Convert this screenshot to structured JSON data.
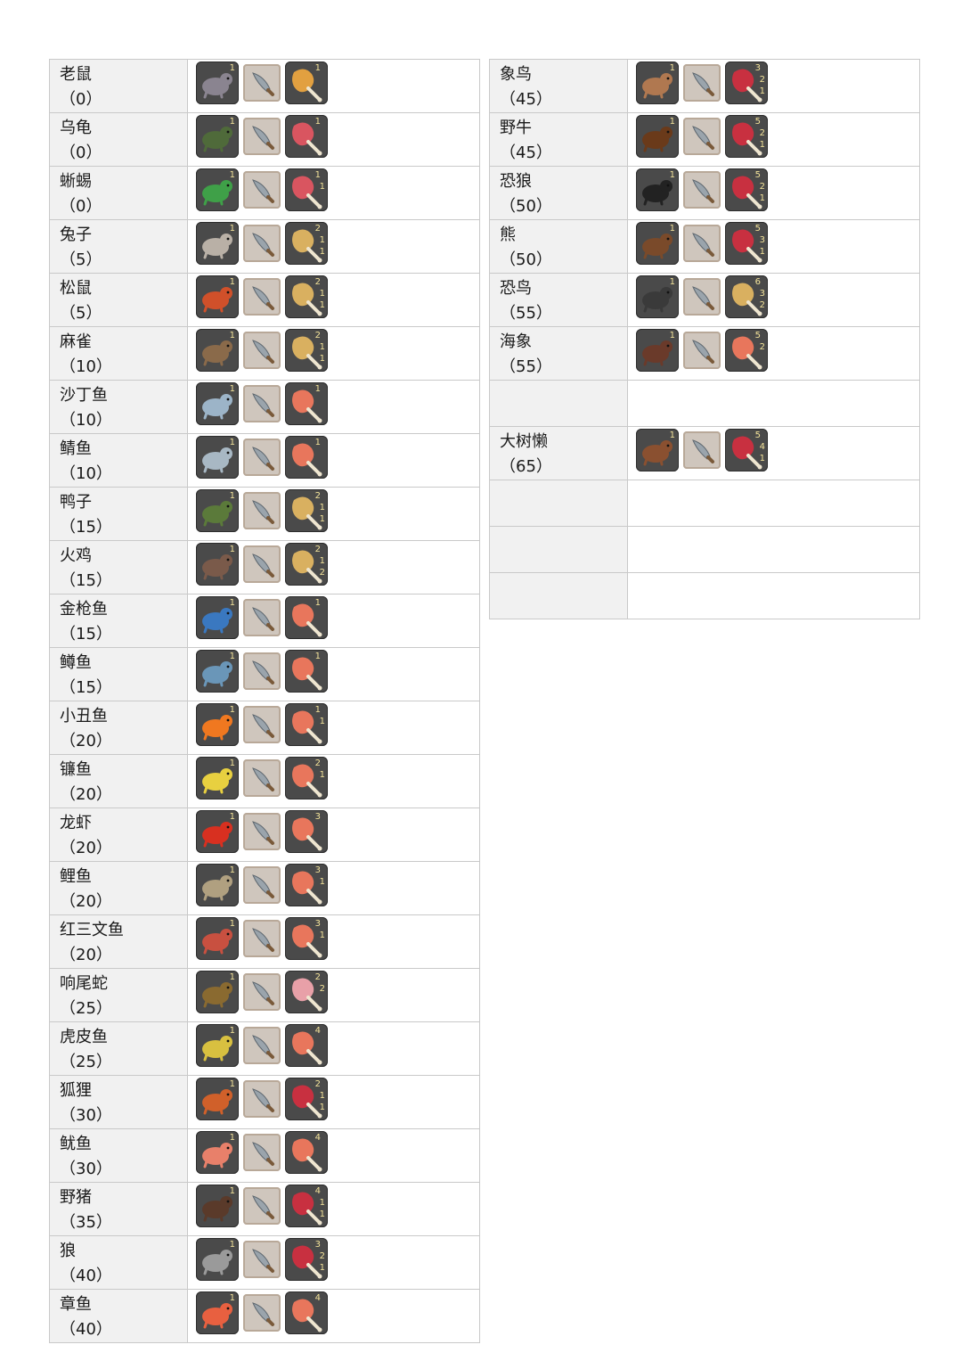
{
  "left_table": [
    {
      "name": "老鼠",
      "value": "（0）",
      "animal_icon": "rat-icon",
      "animal_color": "#8a8490",
      "animal_count": "1",
      "product_icon": "chicken-leg-icon",
      "product_color": "#e2a040",
      "counts": [
        "1"
      ]
    },
    {
      "name": "乌龟",
      "value": "（0）",
      "animal_icon": "turtle-icon",
      "animal_color": "#4f6a3a",
      "animal_count": "1",
      "product_icon": "raw-meat-icon",
      "product_color": "#d95560",
      "counts": [
        "1"
      ]
    },
    {
      "name": "蜥蜴",
      "value": "（0）",
      "animal_icon": "lizard-icon",
      "animal_color": "#3fa048",
      "animal_count": "1",
      "product_icon": "meat-and-hide-icon",
      "product_color": "#d95560",
      "counts": [
        "1",
        "1"
      ]
    },
    {
      "name": "兔子",
      "value": "（5）",
      "animal_icon": "rabbit-icon",
      "animal_color": "#b9b0a6",
      "animal_count": "1",
      "product_icon": "leg-and-fur-icon",
      "product_color": "#d9b060",
      "counts": [
        "2",
        "1",
        "1"
      ]
    },
    {
      "name": "松鼠",
      "value": "（5）",
      "animal_icon": "squirrel-icon",
      "animal_color": "#d0502a",
      "animal_count": "1",
      "product_icon": "leg-and-fur-icon",
      "product_color": "#d9b060",
      "counts": [
        "2",
        "1",
        "1"
      ]
    },
    {
      "name": "麻雀",
      "value": "（10）",
      "animal_icon": "sparrow-icon",
      "animal_color": "#8a6a4a",
      "animal_count": "1",
      "product_icon": "leg-and-feather-icon",
      "product_color": "#d9b060",
      "counts": [
        "2",
        "1",
        "1"
      ]
    },
    {
      "name": "沙丁鱼",
      "value": "（10）",
      "animal_icon": "sardine-icon",
      "animal_color": "#9cb4c8",
      "animal_count": "1",
      "product_icon": "fish-steak-icon",
      "product_color": "#e8765c",
      "counts": [
        "1"
      ]
    },
    {
      "name": "鲭鱼",
      "value": "（10）",
      "animal_icon": "mackerel-icon",
      "animal_color": "#a8b8c4",
      "animal_count": "1",
      "product_icon": "fish-steak-icon",
      "product_color": "#e8765c",
      "counts": [
        "1"
      ]
    },
    {
      "name": "鸭子",
      "value": "（15）",
      "animal_icon": "duck-icon",
      "animal_color": "#5b7a3a",
      "animal_count": "1",
      "product_icon": "leg-and-feather-icon",
      "product_color": "#d9b060",
      "counts": [
        "2",
        "1",
        "1"
      ]
    },
    {
      "name": "火鸡",
      "value": "（15）",
      "animal_icon": "turkey-icon",
      "animal_color": "#7a5a4a",
      "animal_count": "1",
      "product_icon": "leg-and-feather-icon",
      "product_color": "#d9b060",
      "counts": [
        "2",
        "1",
        "2"
      ]
    },
    {
      "name": "金枪鱼",
      "value": "（15）",
      "animal_icon": "tuna-icon",
      "animal_color": "#3a78c0",
      "animal_count": "1",
      "product_icon": "fish-steak-icon",
      "product_color": "#e8765c",
      "counts": [
        "1"
      ]
    },
    {
      "name": "鳟鱼",
      "value": "（15）",
      "animal_icon": "trout-icon",
      "animal_color": "#6a96b8",
      "animal_count": "1",
      "product_icon": "fish-steak-icon",
      "product_color": "#e8765c",
      "counts": [
        "1"
      ]
    },
    {
      "name": "小丑鱼",
      "value": "（20）",
      "animal_icon": "clownfish-icon",
      "animal_color": "#f07820",
      "animal_count": "1",
      "product_icon": "steak-and-scale-icon",
      "product_color": "#e8765c",
      "counts": [
        "1",
        "1"
      ]
    },
    {
      "name": "镰鱼",
      "value": "（20）",
      "animal_icon": "moorish-idol-icon",
      "animal_color": "#e8d040",
      "animal_count": "1",
      "product_icon": "steak-and-scale-icon",
      "product_color": "#e8765c",
      "counts": [
        "2",
        "1"
      ]
    },
    {
      "name": "龙虾",
      "value": "（20）",
      "animal_icon": "lobster-icon",
      "animal_color": "#d83020",
      "animal_count": "1",
      "product_icon": "fish-steak-icon",
      "product_color": "#e8765c",
      "counts": [
        "3"
      ]
    },
    {
      "name": "鲤鱼",
      "value": "（20）",
      "animal_icon": "carp-icon",
      "animal_color": "#b0a080",
      "animal_count": "1",
      "product_icon": "steak-and-scale-icon",
      "product_color": "#e8765c",
      "counts": [
        "3",
        "1"
      ]
    },
    {
      "name": "红三文鱼",
      "value": "（20）",
      "animal_icon": "salmon-icon",
      "animal_color": "#c85040",
      "animal_count": "1",
      "product_icon": "steak-and-scale-icon",
      "product_color": "#e8765c",
      "counts": [
        "3",
        "1"
      ]
    },
    {
      "name": "响尾蛇",
      "value": "（25）",
      "animal_icon": "rattlesnake-icon",
      "animal_color": "#8a6a30",
      "animal_count": "1",
      "product_icon": "meat-and-hide-icon",
      "product_color": "#e8a0a8",
      "counts": [
        "2",
        "2"
      ]
    },
    {
      "name": "虎皮鱼",
      "value": "（25）",
      "animal_icon": "tiger-barb-icon",
      "animal_color": "#d8c040",
      "animal_count": "1",
      "product_icon": "fish-steak-icon",
      "product_color": "#e8765c",
      "counts": [
        "4"
      ]
    },
    {
      "name": "狐狸",
      "value": "（30）",
      "animal_icon": "fox-icon",
      "animal_color": "#d0602a",
      "animal_count": "1",
      "product_icon": "meat-and-leather-icon",
      "product_color": "#c83040",
      "counts": [
        "2",
        "1",
        "1"
      ]
    },
    {
      "name": "鱿鱼",
      "value": "（30）",
      "animal_icon": "squid-icon",
      "animal_color": "#e8806a",
      "animal_count": "1",
      "product_icon": "fish-steak-icon",
      "product_color": "#e8765c",
      "counts": [
        "4"
      ]
    },
    {
      "name": "野猪",
      "value": "（35）",
      "animal_icon": "boar-icon",
      "animal_color": "#5a3a2a",
      "animal_count": "1",
      "product_icon": "meat-and-leather-icon",
      "product_color": "#c83040",
      "counts": [
        "4",
        "1",
        "1"
      ]
    },
    {
      "name": "狼",
      "value": "（40）",
      "animal_icon": "wolf-icon",
      "animal_color": "#9a9a9a",
      "animal_count": "1",
      "product_icon": "meat-and-leather-icon",
      "product_color": "#c83040",
      "counts": [
        "3",
        "2",
        "1"
      ]
    },
    {
      "name": "章鱼",
      "value": "（40）",
      "animal_icon": "octopus-icon",
      "animal_color": "#e86040",
      "animal_count": "1",
      "product_icon": "fish-steak-icon",
      "product_color": "#e8765c",
      "counts": [
        "4"
      ]
    }
  ],
  "right_table": [
    {
      "name": "象鸟",
      "value": "（45）",
      "animal_icon": "elephant-bird-icon",
      "animal_color": "#b07850",
      "animal_count": "1",
      "product_icon": "meat-bone-feather-icon",
      "product_color": "#c83040",
      "counts": [
        "3",
        "2",
        "1"
      ]
    },
    {
      "name": "野牛",
      "value": "（45）",
      "animal_icon": "bison-icon",
      "animal_color": "#6a3a1a",
      "animal_count": "1",
      "product_icon": "meat-bone-hide-icon",
      "product_color": "#c83040",
      "counts": [
        "5",
        "2",
        "1"
      ]
    },
    {
      "name": "恐狼",
      "value": "（50）",
      "animal_icon": "dire-wolf-icon",
      "animal_color": "#222222",
      "animal_count": "1",
      "product_icon": "meat-bone-hide-icon",
      "product_color": "#c83040",
      "counts": [
        "5",
        "2",
        "1"
      ]
    },
    {
      "name": "熊",
      "value": "（50）",
      "animal_icon": "bear-icon",
      "animal_color": "#7a4a2a",
      "animal_count": "1",
      "product_icon": "meat-bone-hide-icon",
      "product_color": "#c83040",
      "counts": [
        "5",
        "3",
        "1"
      ]
    },
    {
      "name": "恐鸟",
      "value": "（55）",
      "animal_icon": "terror-bird-icon",
      "animal_color": "#3a3a3a",
      "animal_count": "1",
      "product_icon": "leg-bone-feather-icon",
      "product_color": "#d9b060",
      "counts": [
        "6",
        "3",
        "2"
      ]
    },
    {
      "name": "海象",
      "value": "（55）",
      "animal_icon": "walrus-icon",
      "animal_color": "#6a3a2a",
      "animal_count": "1",
      "product_icon": "meat-bone-icon",
      "product_color": "#e8765c",
      "counts": [
        "5",
        "2"
      ]
    },
    {
      "name": "",
      "value": "",
      "empty": true
    },
    {
      "name": "大树懒",
      "value": "（65）",
      "animal_icon": "ground-sloth-icon",
      "animal_color": "#8a5030",
      "animal_count": "1",
      "product_icon": "meat-bone-hide-icon",
      "product_color": "#c83040",
      "counts": [
        "5",
        "4",
        "1"
      ]
    },
    {
      "name": "",
      "value": "",
      "empty": true
    },
    {
      "name": "",
      "value": "",
      "empty": true
    },
    {
      "name": "",
      "value": "",
      "empty": true
    }
  ],
  "knife_icon": "knife-icon"
}
